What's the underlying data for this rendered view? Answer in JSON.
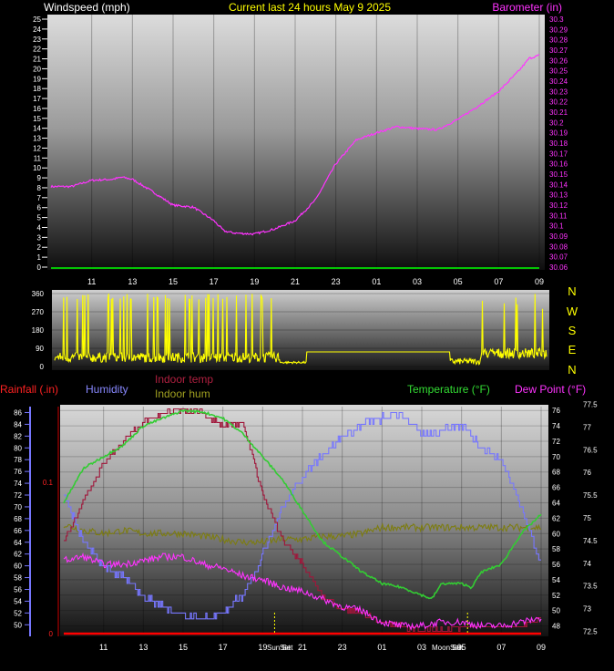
{
  "colors": {
    "windspeed": "#ff33ff",
    "barometer": "#ff33ff",
    "winddir": "#ffff00",
    "temperature": "#33cc33",
    "dewpoint": "#ff33ff",
    "humidity": "#7777ff",
    "rainfall": "#ff0000",
    "indoor_temp": "#a0163a",
    "indoor_hum": "#7d7d10",
    "title": "#ffff00",
    "tick_white": "#ffffff"
  },
  "header": {
    "left": "Windspeed (mph)",
    "center": "Current last 24 hours May 9 2025",
    "right": "Barometer (in)"
  },
  "labels": {
    "rainfall": "Rainfall (.in)",
    "humidity": "Humidity",
    "indoor_temp": "Indoor temp",
    "indoor_hum": "Indoor hum",
    "temperature": "Temperature (°F)",
    "dewpoint": "Dew Point (°F)",
    "sunset": "Sun Set",
    "sunset_dup": "Set",
    "moonset": "Moon Set",
    "moonset_dup": "Set"
  },
  "compass": [
    "N",
    "W",
    "S",
    "E",
    "N"
  ],
  "x_ticks": [
    "11",
    "13",
    "15",
    "17",
    "19",
    "21",
    "23",
    "01",
    "03",
    "05",
    "07",
    "09"
  ],
  "chart_data": [
    {
      "type": "line",
      "panel": "top",
      "left_axis": {
        "label": "Windspeed (mph)",
        "range": [
          0,
          25
        ],
        "ticks": [
          0,
          1,
          2,
          3,
          4,
          5,
          6,
          7,
          8,
          9,
          10,
          11,
          12,
          13,
          14,
          15,
          16,
          17,
          18,
          19,
          20,
          21,
          22,
          23,
          24,
          25
        ]
      },
      "right_axis": {
        "label": "Barometer (in)",
        "range": [
          30.06,
          30.3
        ],
        "ticks": [
          "30.06",
          "30.07",
          "30.08",
          "30.09",
          "30.1",
          "30.11",
          "30.12",
          "30.13",
          "30.14",
          "30.15",
          "30.16",
          "30.17",
          "30.18",
          "30.19",
          "30.2",
          "30.21",
          "30.22",
          "30.23",
          "30.24",
          "30.25",
          "30.26",
          "30.27",
          "30.28",
          "30.29",
          "30.3"
        ]
      },
      "x": {
        "start_hour": 9,
        "hours": 24,
        "ticks": [
          "11",
          "13",
          "15",
          "17",
          "19",
          "21",
          "23",
          "01",
          "03",
          "05",
          "07",
          "09"
        ]
      },
      "series": [
        {
          "name": "Barometer (in)",
          "axis": "right",
          "x_hours": [
            0,
            1,
            2,
            3,
            3.5,
            4,
            5,
            6,
            7,
            8,
            8.5,
            9,
            10,
            11,
            12,
            13,
            14,
            15,
            16,
            17,
            18,
            19,
            20,
            21,
            22,
            23,
            23.5,
            24
          ],
          "values": [
            30.138,
            30.138,
            30.144,
            30.145,
            30.147,
            30.145,
            30.133,
            30.12,
            30.118,
            30.105,
            30.095,
            30.093,
            30.092,
            30.097,
            30.105,
            30.125,
            30.16,
            30.183,
            30.19,
            30.196,
            30.194,
            30.193,
            30.203,
            30.216,
            30.23,
            30.25,
            30.262,
            30.265
          ]
        },
        {
          "name": "Windspeed (mph)",
          "axis": "left",
          "x_hours": [
            0,
            24
          ],
          "values": [
            0,
            0
          ]
        }
      ]
    },
    {
      "type": "line",
      "panel": "wind_direction",
      "left_axis": {
        "range": [
          0,
          360
        ],
        "ticks": [
          0,
          90,
          180,
          270,
          360
        ]
      },
      "right_labels": [
        "N",
        "W",
        "S",
        "E",
        "N"
      ],
      "series": [
        {
          "name": "Wind direction",
          "note": "spiky 0-360 until ~20h, flat near 70 deg through night, spiky again after 07"
        }
      ]
    },
    {
      "type": "line",
      "panel": "bottom",
      "left_axis_rain": {
        "label": "Rainfall (.in)",
        "range": [
          0,
          0.15
        ],
        "ticks": [
          "0",
          "0.1"
        ]
      },
      "left_axis_hum": {
        "label": "Humidity",
        "range": [
          48.5,
          87
        ],
        "ticks": [
          50,
          52,
          54,
          56,
          58,
          60,
          62,
          64,
          66,
          68,
          70,
          72,
          74,
          76,
          78,
          80,
          82,
          84,
          86
        ]
      },
      "right_axis_temp": {
        "label": "Temperature (°F)",
        "range": [
          47,
          76.5
        ],
        "ticks": [
          48,
          50,
          52,
          54,
          56,
          58,
          60,
          62,
          64,
          66,
          68,
          70,
          72,
          74,
          76
        ]
      },
      "right_axis_indoor": {
        "label": "Indoor temp",
        "range": [
          72.45,
          77.45
        ],
        "ticks": [
          "72.5",
          "73",
          "73.5",
          "74",
          "74.5",
          "75",
          "75.5",
          "76",
          "76.5",
          "77",
          "77.5"
        ]
      },
      "x": {
        "start_hour": 9,
        "hours": 24,
        "ticks": [
          "11",
          "13",
          "15",
          "17",
          "19",
          "21",
          "23",
          "01",
          "03",
          "05",
          "07",
          "09"
        ]
      },
      "series": [
        {
          "name": "Temperature (°F)",
          "axis": "temp",
          "x_hours": [
            0,
            1,
            2,
            3,
            4,
            5,
            6,
            7,
            8,
            9,
            10,
            11,
            12,
            13,
            14,
            15,
            16,
            17,
            18,
            18.5,
            19,
            20,
            20.5,
            21,
            22,
            23,
            24
          ],
          "values": [
            64,
            68.5,
            70,
            71.5,
            74,
            75,
            76,
            75.8,
            75,
            73,
            70,
            67,
            63,
            59,
            57,
            55,
            53.5,
            53,
            52,
            51.5,
            53.5,
            53.5,
            53,
            55,
            56,
            60,
            62.5
          ]
        },
        {
          "name": "Dew Point (°F)",
          "axis": "temp",
          "x_hours": [
            0,
            1,
            2,
            3,
            4,
            5,
            6,
            7,
            8,
            9,
            10,
            11,
            12,
            13,
            14,
            15,
            16,
            17,
            18,
            19,
            20,
            21,
            22,
            23,
            24
          ],
          "values": [
            56.5,
            57,
            56,
            56,
            56.5,
            57,
            57,
            56,
            55.5,
            54.5,
            54,
            53,
            52.5,
            51.5,
            50.5,
            50,
            48.5,
            48,
            48,
            48.5,
            48.5,
            48,
            48,
            48.5,
            49
          ]
        },
        {
          "name": "Humidity",
          "axis": "hum",
          "x_hours": [
            0,
            1,
            2,
            3,
            4,
            5,
            6,
            7,
            8,
            9,
            10,
            11,
            12,
            13,
            14,
            15,
            16,
            17,
            18,
            19,
            20,
            21,
            22,
            23,
            24
          ],
          "values": [
            72,
            64,
            60,
            58,
            55,
            53,
            51.5,
            51,
            52,
            55,
            62,
            70,
            75,
            79,
            82,
            84,
            85,
            86,
            82,
            83,
            84,
            80,
            78,
            70,
            60
          ]
        },
        {
          "name": "Indoor temp",
          "axis": "indoor",
          "x_hours": [
            0,
            0.5,
            1,
            1.5,
            2,
            3,
            4,
            5,
            6,
            7,
            8,
            9,
            10,
            11,
            12,
            13,
            14,
            15,
            16,
            17,
            18,
            19,
            20,
            21,
            22,
            23,
            24
          ],
          "values": [
            74.5,
            74.9,
            75.4,
            75.8,
            76.2,
            76.7,
            77.1,
            77.3,
            77.4,
            77.3,
            77,
            77.1,
            75.5,
            74.5,
            74,
            73.3,
            73,
            72.9,
            72.7,
            72.6,
            72.55,
            72.55,
            72.6,
            72.6,
            72.6,
            72.6,
            72.8
          ]
        },
        {
          "name": "Indoor hum",
          "axis": "hum",
          "x_hours": [
            0,
            1,
            2,
            3,
            4,
            5,
            6,
            7,
            8,
            9,
            10,
            11,
            12,
            13,
            14,
            15,
            16,
            17,
            18,
            19,
            20,
            21,
            22,
            23,
            24
          ],
          "values": [
            67,
            66,
            65.5,
            66,
            65.5,
            65.5,
            65.5,
            65,
            64.5,
            64,
            64,
            64.5,
            64.5,
            65,
            65,
            65.5,
            66.5,
            66.5,
            66.5,
            66.5,
            66.5,
            66.5,
            66.5,
            66.5,
            66.5
          ]
        },
        {
          "name": "Rainfall (.in)",
          "axis": "rain",
          "x_hours": [
            0,
            24
          ],
          "values": [
            0,
            0
          ]
        }
      ],
      "markers": [
        {
          "label": "Sun Set",
          "x_hour": 10.6
        },
        {
          "label": "Moon Set",
          "x_hour": 20.3
        }
      ]
    }
  ]
}
